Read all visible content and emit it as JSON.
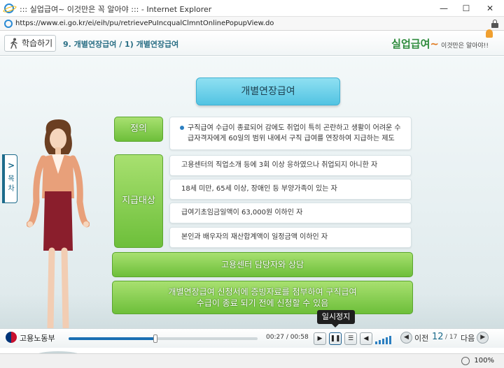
{
  "window": {
    "title": "::: 실업급여~ 이것만은 꼭 알아야 ::: - Internet Explorer",
    "min": "—",
    "max": "☐",
    "close": "✕",
    "url": "https://www.ei.go.kr/ei/eih/pu/retrievePuIncqualClmntOnlinePopupView.do"
  },
  "header": {
    "learn_button": "학습하기",
    "breadcrumb": "9. 개별연장급여 / 1) 개별연장급여",
    "logo_main": "실업급여",
    "logo_tilde": "~",
    "logo_sub": "이것만은 알아야!!"
  },
  "side_tab": {
    "chevron": ">",
    "label": "목차"
  },
  "content": {
    "title": "개별연장급여",
    "definition_label": "정의",
    "definition_text": "구직급여 수급이 종료되어 감에도 취업이 특히 곤란하고 생활이 어려운 수급자격자에게 60일의 범위 내에서 구직 급여를 연장하여 지급하는 제도",
    "target_label": "지급대상",
    "criteria": [
      "고용센터의 직업소개 등에 3회 이상 응하였으나 취업되지 아니한 자",
      "18세 미만, 65세 이상, 장애인 등 부양가족이 있는 자",
      "급여기초임금일액이 63,000원 이하인 자",
      "본인과 배우자의 재산합계액이 일정금액 이하인 자"
    ],
    "consult_bar": "고용센터 담당자와 상담",
    "apply_line1": "개별연장급여 신청서에 증빙자료를 첨부하여 구직급여",
    "apply_line2": "수급이 종료 되기 전에 신청할 수 있음"
  },
  "player": {
    "ministry": "고용노동부",
    "progress": 0.46,
    "time_current": "00:27",
    "time_separator": "/",
    "time_total": "00:58",
    "play_icon": "▶",
    "pause_icon": "❚❚",
    "menu_icon": "☰",
    "volume_icon": "◀",
    "tooltip": "일시정지",
    "prev_label": "이전",
    "page_current": "12",
    "page_total": "/ 17",
    "next_label": "다음",
    "prev_icon": "◀",
    "next_icon": "▶"
  },
  "statusbar": {
    "zoom": "100%"
  },
  "colors": {
    "accent_blue": "#1c6b8b",
    "green": "#6dbf3a",
    "title_cyan": "#52c3e2"
  }
}
